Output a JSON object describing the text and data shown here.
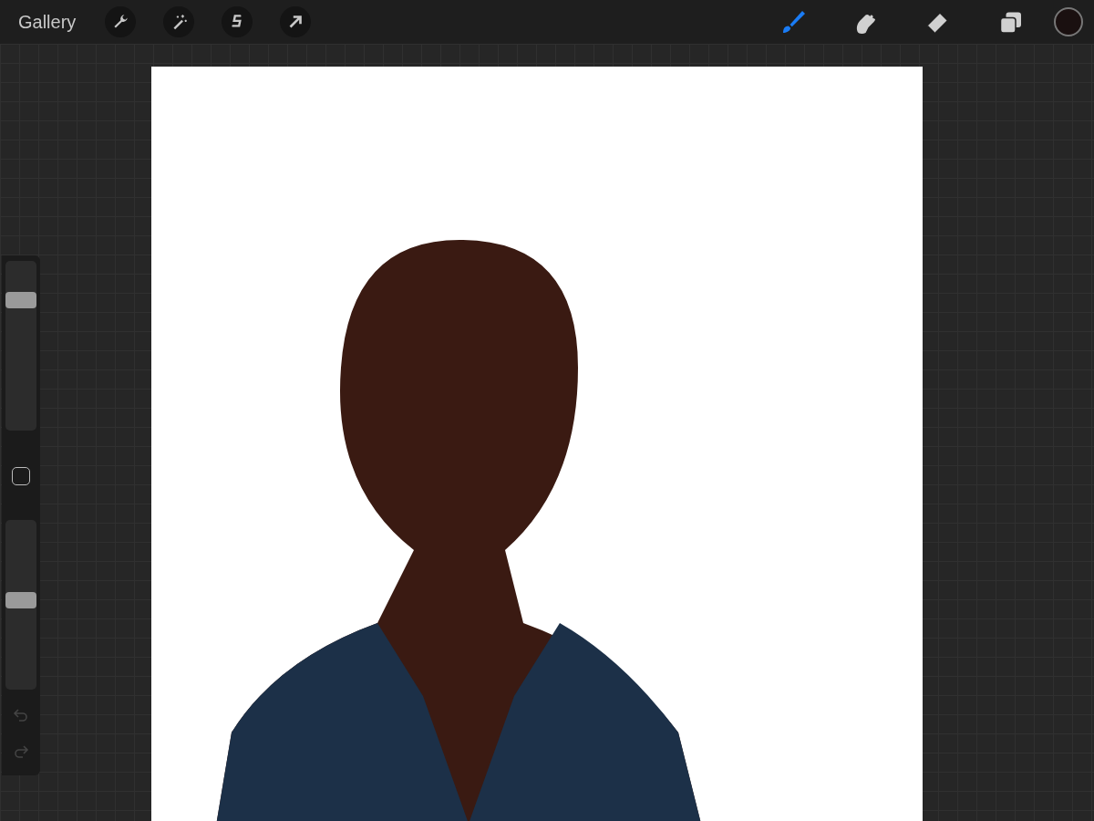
{
  "top_bar": {
    "gallery": "Gallery",
    "left_tools": [
      {
        "kind": "wrench"
      },
      {
        "kind": "wand"
      },
      {
        "kind": "selection"
      },
      {
        "kind": "transform"
      }
    ],
    "right_tools": [
      {
        "kind": "brush",
        "selected": true
      },
      {
        "kind": "smudge",
        "selected": false
      },
      {
        "kind": "eraser",
        "selected": false
      },
      {
        "kind": "layers",
        "selected": false
      }
    ],
    "color_swatch": {
      "color": "#1a1010"
    }
  },
  "sidebar": {
    "size_slider": {
      "level": 0.8
    },
    "opacity_slider": {
      "level": 0.53
    },
    "undo": {
      "disabled": true
    },
    "redo": {
      "disabled": true
    }
  }
}
